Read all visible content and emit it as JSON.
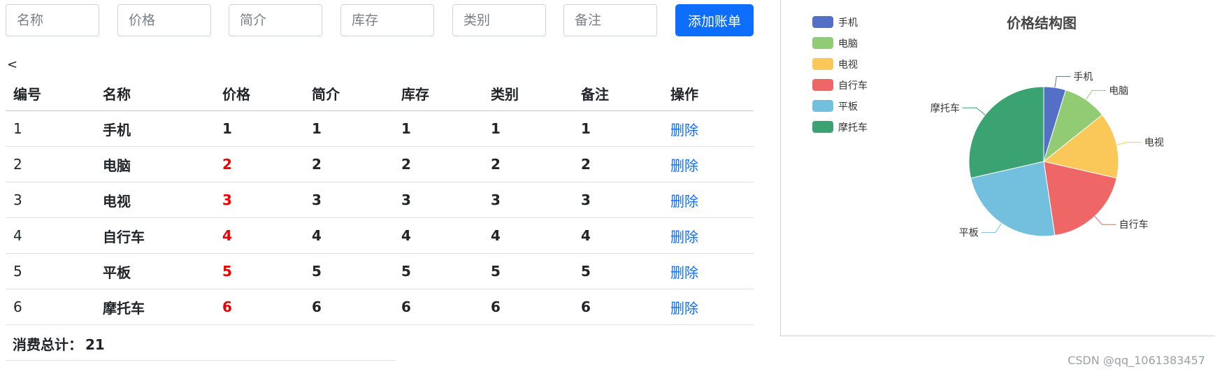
{
  "form": {
    "fields": [
      {
        "placeholder": "名称"
      },
      {
        "placeholder": "价格"
      },
      {
        "placeholder": "简介"
      },
      {
        "placeholder": "库存"
      },
      {
        "placeholder": "类别"
      },
      {
        "placeholder": "备注"
      }
    ],
    "add_button": "添加账单"
  },
  "back_link": "<",
  "table": {
    "headers": [
      "编号",
      "名称",
      "价格",
      "简介",
      "库存",
      "类别",
      "备注",
      "操作"
    ],
    "rows": [
      {
        "id": "1",
        "name": "手机",
        "price": "1",
        "intro": "1",
        "stock": "1",
        "category": "1",
        "remark": "1",
        "action": "删除"
      },
      {
        "id": "2",
        "name": "电脑",
        "price": "2",
        "intro": "2",
        "stock": "2",
        "category": "2",
        "remark": "2",
        "action": "删除"
      },
      {
        "id": "3",
        "name": "电视",
        "price": "3",
        "intro": "3",
        "stock": "3",
        "category": "3",
        "remark": "3",
        "action": "删除"
      },
      {
        "id": "4",
        "name": "自行车",
        "price": "4",
        "intro": "4",
        "stock": "4",
        "category": "4",
        "remark": "4",
        "action": "删除"
      },
      {
        "id": "5",
        "name": "平板",
        "price": "5",
        "intro": "5",
        "stock": "5",
        "category": "5",
        "remark": "5",
        "action": "删除"
      },
      {
        "id": "6",
        "name": "摩托车",
        "price": "6",
        "intro": "6",
        "stock": "6",
        "category": "6",
        "remark": "6",
        "action": "删除"
      }
    ],
    "price_colors": {
      "default": "#212529",
      "highlight": "#ee0000"
    }
  },
  "total": {
    "label": "消费总计：",
    "value": "21"
  },
  "watermark": "CSDN @qq_1061383457",
  "chart_data": {
    "type": "pie",
    "title": "价格结构图",
    "legend_position": "top-left",
    "labels": [
      "手机",
      "电脑",
      "电视",
      "自行车",
      "平板",
      "摩托车"
    ],
    "values": [
      1,
      2,
      3,
      4,
      5,
      6
    ],
    "colors": [
      "#5470c6",
      "#91cc75",
      "#fac858",
      "#ee6666",
      "#73c0de",
      "#3ba272"
    ]
  }
}
